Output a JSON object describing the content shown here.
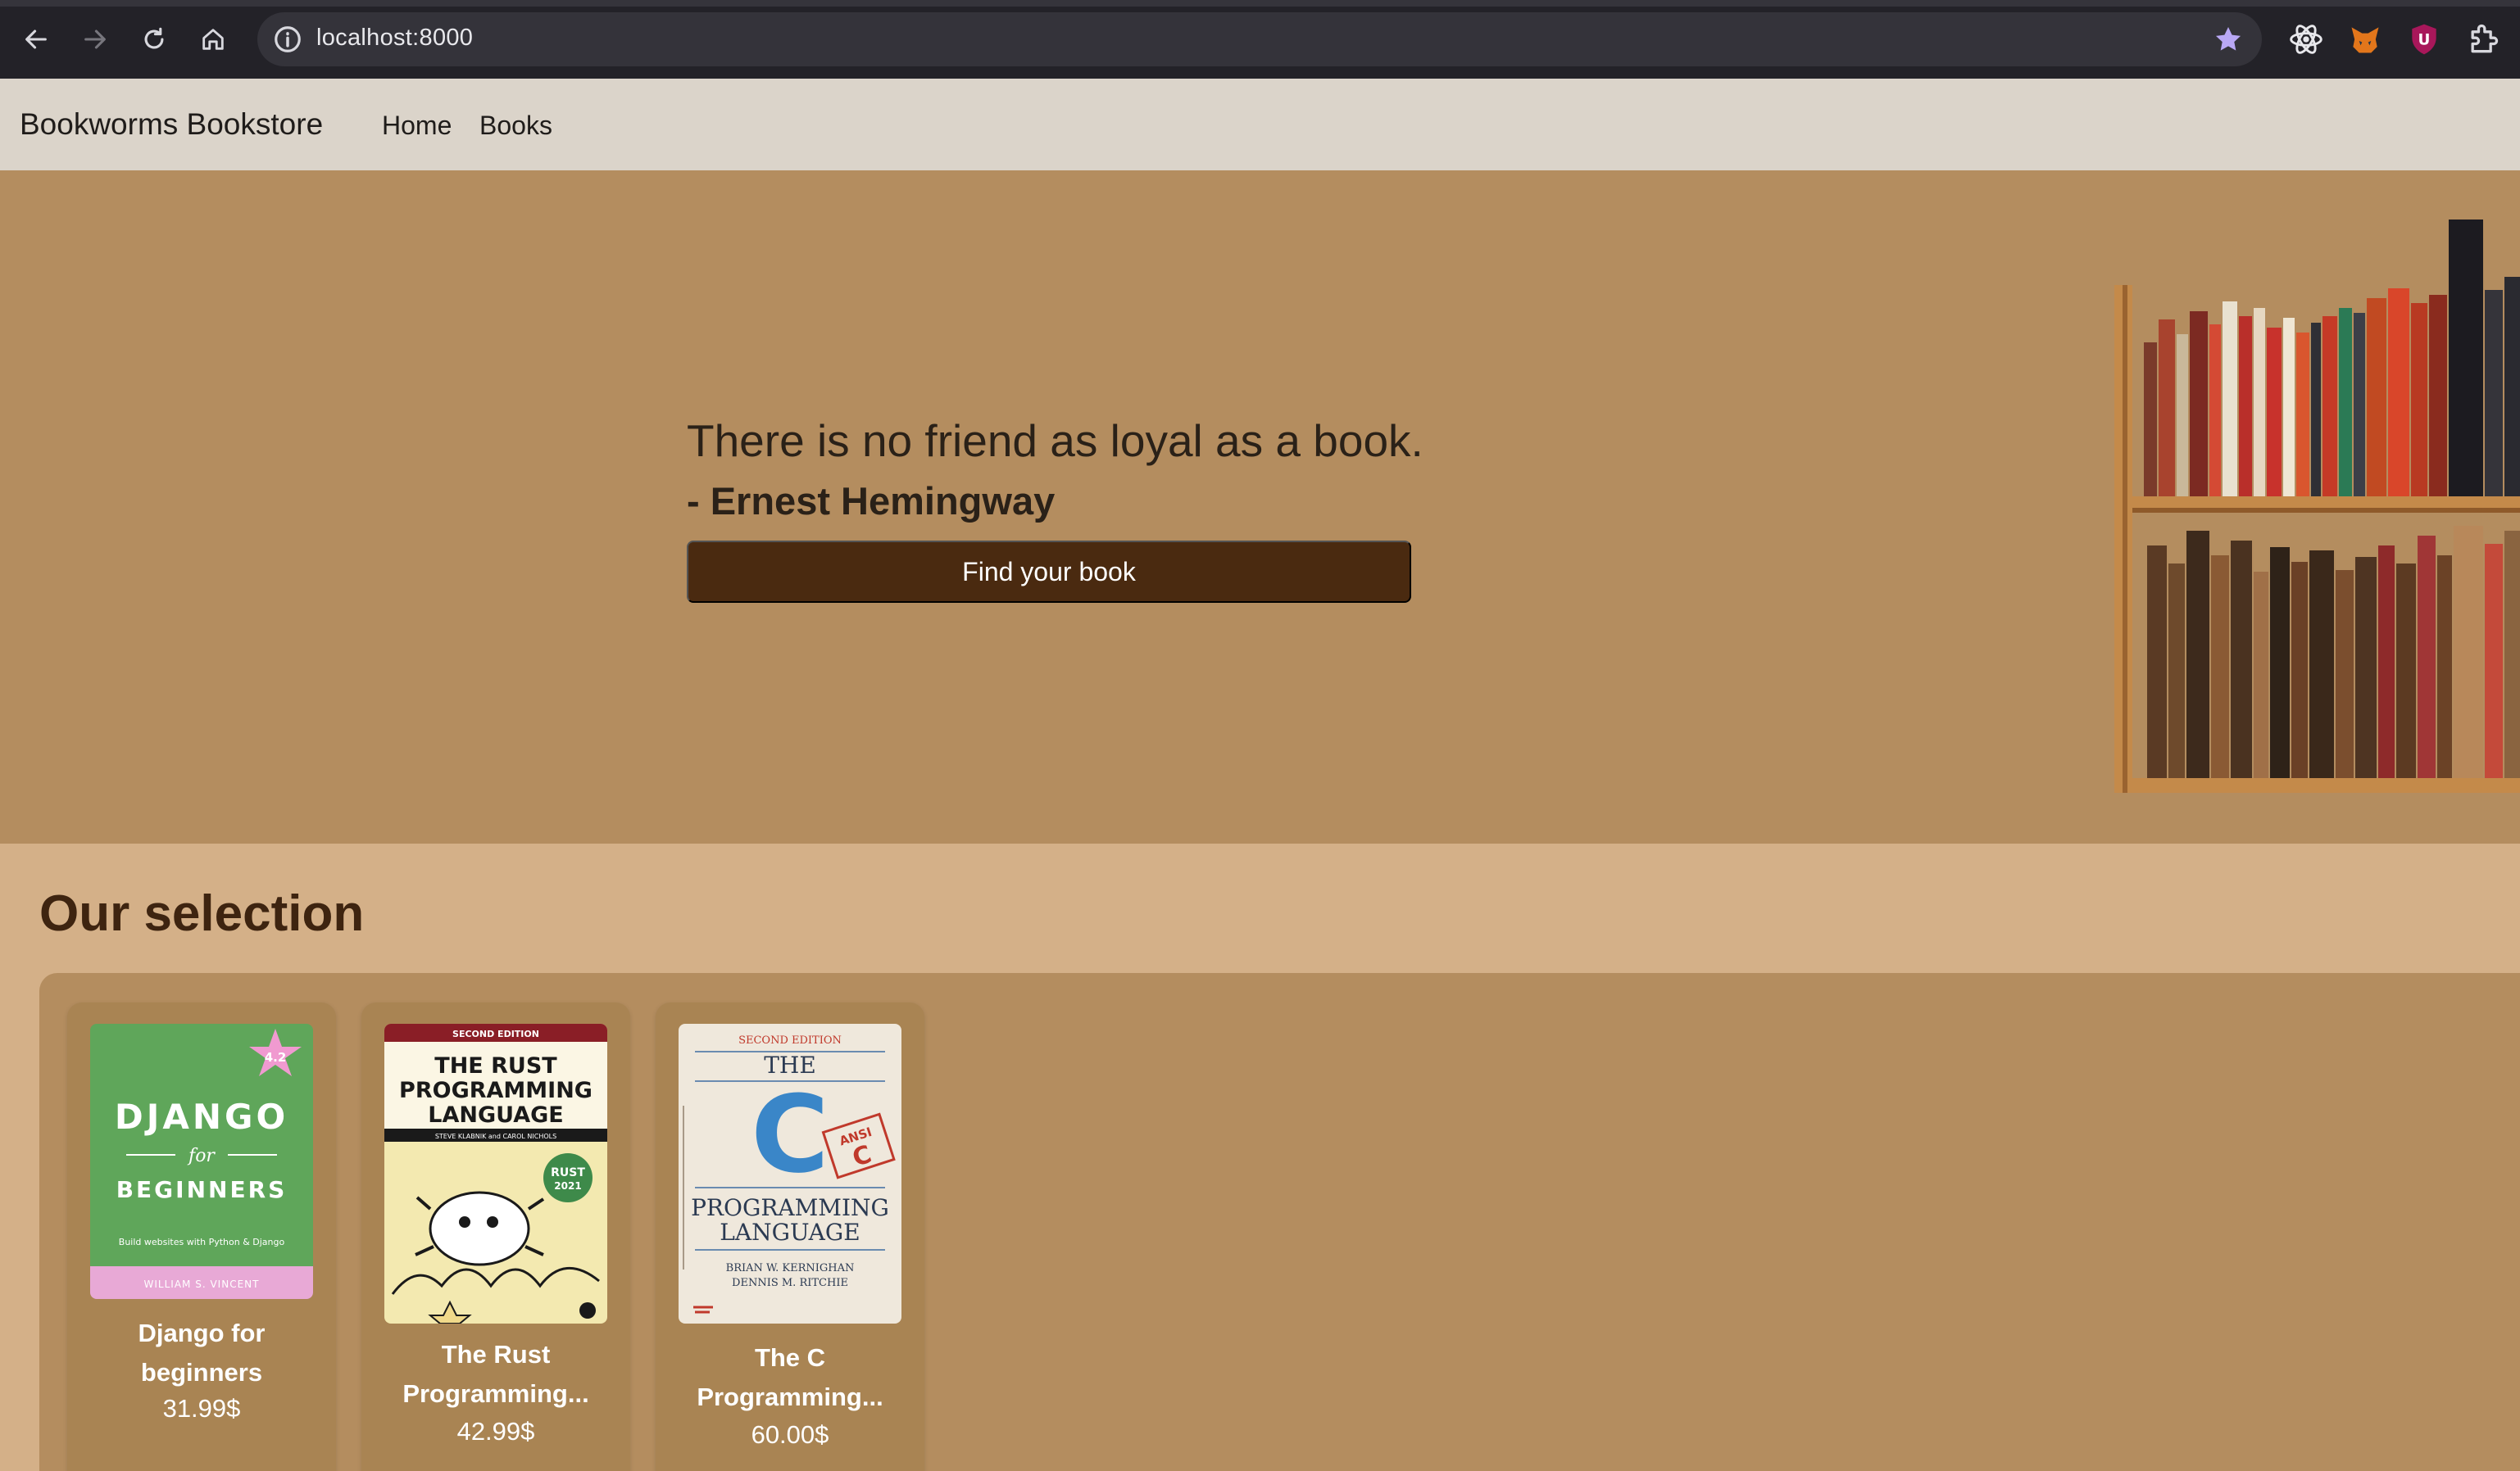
{
  "browser": {
    "url": "localhost:8000"
  },
  "navbar": {
    "brand": "Bookworms Bookstore",
    "links": [
      "Home",
      "Books"
    ]
  },
  "hero": {
    "quote": "There is no friend as loyal as a book.",
    "author": "- Ernest Hemingway",
    "cta": "Find your book"
  },
  "selection": {
    "title": "Our selection",
    "books": [
      {
        "title": "Django for beginners",
        "price": "31.99$",
        "cover": {
          "badge": "4.2",
          "line1": "DJANGO",
          "line2": "for",
          "line3": "BEGINNERS",
          "subtitle": "Build websites with Python & Django",
          "author": "WILLIAM S. VINCENT"
        }
      },
      {
        "title": "The Rust Programming...",
        "price": "42.99$",
        "cover": {
          "edition": "SECOND EDITION",
          "line1": "THE RUST",
          "line2": "PROGRAMMING",
          "line3": "LANGUAGE",
          "credits": "STEVE KLABNIK and CAROL NICHOLS",
          "badge1": "RUST",
          "badge2": "2021"
        }
      },
      {
        "title": "The C Programming...",
        "price": "60.00$",
        "cover": {
          "edition": "SECOND EDITION",
          "line1": "THE",
          "letter": "C",
          "stamp1": "ANSI",
          "stamp2": "C",
          "line2": "PROGRAMMING",
          "line3": "LANGUAGE",
          "author1": "BRIAN W. KERNIGHAN",
          "author2": "DENNIS M. RITCHIE"
        }
      }
    ]
  },
  "colors": {
    "hero_bg": "#b48d5f",
    "section_bg": "#d4b088",
    "button_bg": "#4a2a10",
    "navbar_bg": "#dbd4ca"
  }
}
